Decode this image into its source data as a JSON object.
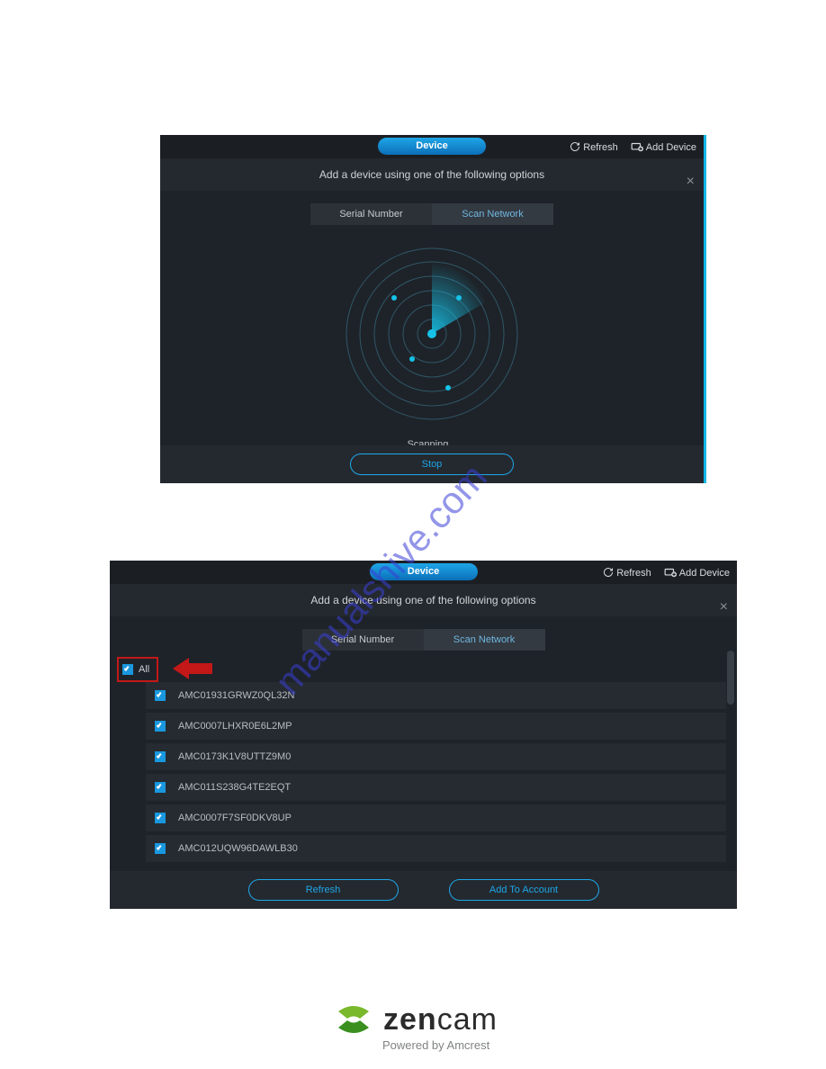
{
  "panel_common": {
    "device_pill": "Device",
    "refresh": "Refresh",
    "add_device": "Add Device",
    "heading": "Add a device using one of the following options",
    "tab_serial": "Serial Number",
    "tab_scan": "Scan Network"
  },
  "panel1": {
    "scanning": "Scanning...",
    "stop": "Stop"
  },
  "panel2": {
    "all": "All",
    "devices": [
      "AMC01931GRWZ0QL32N",
      "AMC0007LHXR0E6L2MP",
      "AMC0173K1V8UTTZ9M0",
      "AMC011S238G4TE2EQT",
      "AMC0007F7SF0DKV8UP",
      "AMC012UQW96DAWLB30"
    ],
    "refresh_btn": "Refresh",
    "add_btn": "Add To Account"
  },
  "watermark": "manualshive.com",
  "logo": {
    "brand_bold": "zen",
    "brand_rest": "cam",
    "sub": "Powered by Amcrest"
  }
}
